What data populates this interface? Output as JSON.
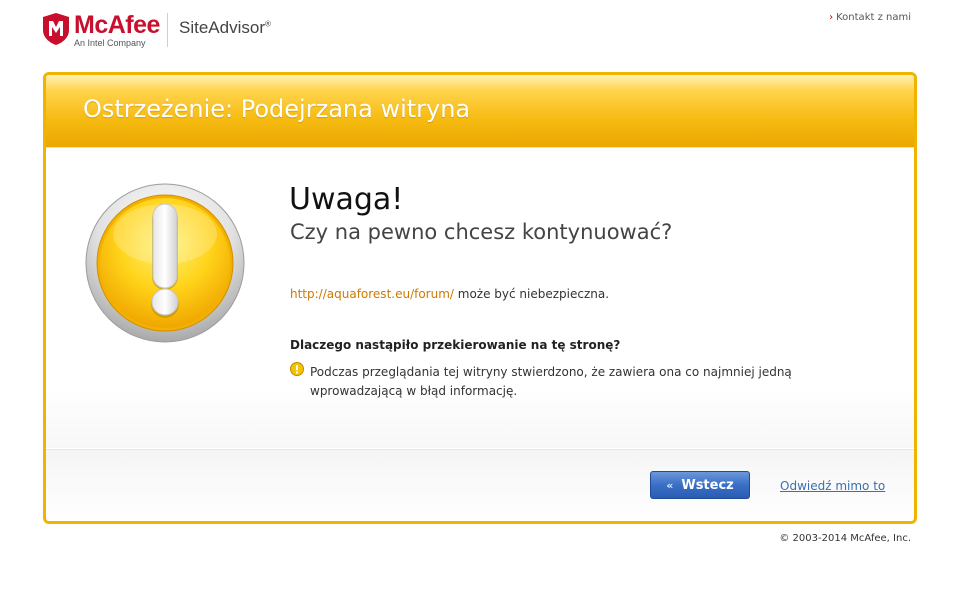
{
  "header": {
    "brand_name": "McAfee",
    "brand_sub": "An Intel Company",
    "product_name": "SiteAdvisor",
    "product_mark": "®",
    "contact_link": "Kontakt z nami"
  },
  "panel": {
    "title": "Ostrzeżenie: Podejrzana witryna",
    "heading": "Uwaga!",
    "subheading": "Czy na pewno chcesz kontynuować?",
    "url": "http://aquaforest.eu/forum/",
    "url_suffix": " może być niebezpieczna.",
    "why_title": "Dlaczego nastąpiło przekierowanie na tę stronę?",
    "why_text": "Podczas przeglądania tej witryny stwierdzono, że zawiera ona co najmniej jedną wprowadzającą w błąd informację."
  },
  "footer": {
    "back_label": "Wstecz",
    "ignore_label": "Odwiedź mimo to"
  },
  "copyright": "© 2003-2014 McAfee, Inc.",
  "colors": {
    "panel_border": "#f0b400",
    "brand_red": "#c8102e",
    "link_orange": "#cc7a00",
    "link_blue": "#3a6fb5",
    "button_blue": "#3a6fc6"
  },
  "icons": {
    "brand": "mcafee-shield-icon",
    "warning_large": "exclamation-warning-icon",
    "warning_small": "small-warning-icon",
    "back": "double-chevron-left-icon"
  }
}
